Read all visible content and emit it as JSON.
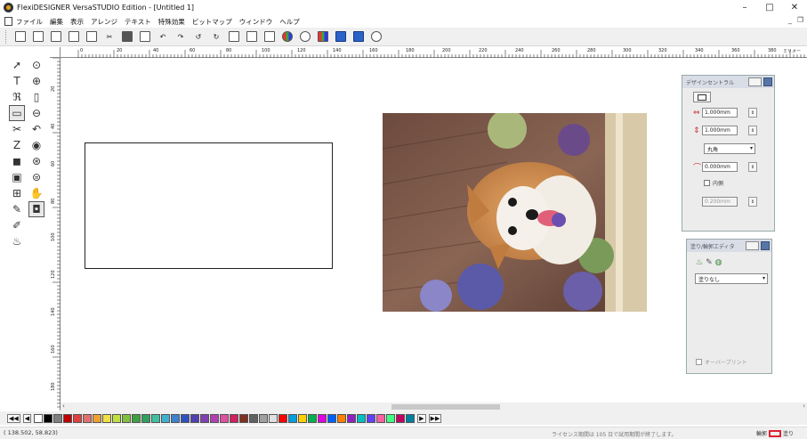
{
  "window": {
    "title": "FlexiDESIGNER VersaSTUDIO Edition - [Untitled 1]",
    "minimize": "–",
    "maximize": "□",
    "close": "✕"
  },
  "menu": {
    "items": [
      "ファイル",
      "編集",
      "表示",
      "アレンジ",
      "テキスト",
      "特殊効果",
      "ビットマップ",
      "ウィンドウ",
      "ヘルプ"
    ],
    "mdi_min": "_",
    "mdi_restore": "❐"
  },
  "toolbar": {
    "icons": [
      "new-icon",
      "open-icon",
      "save-icon",
      "print-icon",
      "send-icon",
      "cut-icon",
      "copy-icon",
      "paste-icon",
      "undo-icon",
      "redo-icon",
      "undo-history-icon",
      "redo-history-icon",
      "page-setup-icon",
      "properties-icon",
      "design-central-icon",
      "color-wheel-icon",
      "zoom-icon",
      "color-icon",
      "spot-color-icon",
      "production-manager-icon",
      "cut-output-icon"
    ]
  },
  "ruler": {
    "h_labels": [
      "0",
      "20",
      "40",
      "60",
      "80",
      "100",
      "120",
      "140",
      "160",
      "180",
      "200",
      "220",
      "240",
      "260",
      "280",
      "300",
      "320",
      "340",
      "360",
      "380",
      "ミリメー"
    ],
    "v_labels": [
      "20",
      "40",
      "60",
      "80",
      "100",
      "120",
      "140",
      "160",
      "180"
    ]
  },
  "design_central": {
    "title": "デザインセントラル",
    "width_value": "1.000mm",
    "height_value": "1.000mm",
    "corner_type": "丸角",
    "radius_value": "0.000mm",
    "inner_checkbox": "内側",
    "offset_value": "0.200mm"
  },
  "fill_editor": {
    "title": "塗り/輪郭エディタ",
    "fill_type": "塗りなし",
    "overprint_label": "オーバープリント"
  },
  "palette": {
    "colors": [
      "#ffffff",
      "#000000",
      "#7f7f7f",
      "#c00000",
      "#e04040",
      "#e07070",
      "#f0a030",
      "#f0e040",
      "#c0e040",
      "#80c040",
      "#40a040",
      "#30a060",
      "#40c0a0",
      "#40b0d0",
      "#4080d0",
      "#3050c0",
      "#5040b0",
      "#8040b0",
      "#b040b0",
      "#e050a0",
      "#d02060",
      "#803020",
      "#606060",
      "#a0a0a0",
      "#e0e0e0",
      "#ff0000",
      "#00a0e0",
      "#ffd000",
      "#00b050",
      "#e000e0",
      "#0060ff",
      "#ff8000",
      "#9020c0",
      "#00c0c0",
      "#6040ff",
      "#ff60a0",
      "#40ff80",
      "#c00060",
      "#0080a0"
    ],
    "nav_first": "◀◀",
    "nav_prev": "◀",
    "nav_next": "▶",
    "nav_last": "▶▶"
  },
  "status": {
    "coords": "( 138.502,  58.823)",
    "license": "ライセンス期間は 105 日で試用期間が終了します。",
    "stroke_label": "輪郭",
    "fill_label": "塗り"
  }
}
